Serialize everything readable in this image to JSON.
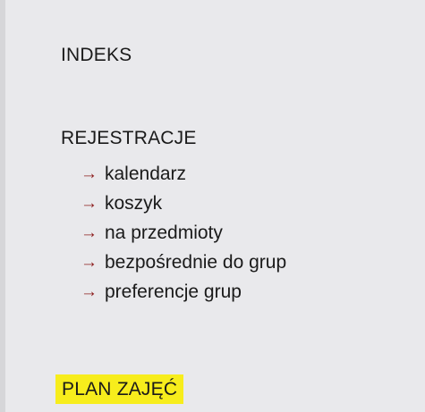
{
  "menu": {
    "indeks": "INDEKS",
    "rejestracje": "REJESTRACJE",
    "rejestracje_items": [
      {
        "label": "kalendarz",
        "icon": "arrow-right-icon"
      },
      {
        "label": "koszyk",
        "icon": "arrow-right-icon"
      },
      {
        "label": "na przedmioty",
        "icon": "arrow-right-icon"
      },
      {
        "label": "bezpośrednie do grup",
        "icon": "arrow-right-icon"
      },
      {
        "label": "preferencje grup",
        "icon": "arrow-right-icon"
      }
    ],
    "plan_zajec": "PLAN ZAJĘĆ",
    "arrow_glyph": "→"
  },
  "colors": {
    "sidebar_bg": "#e9e9ec",
    "arrow": "#8b1a1a",
    "highlight": "#f7ed1c",
    "text": "#1a1a1a"
  }
}
